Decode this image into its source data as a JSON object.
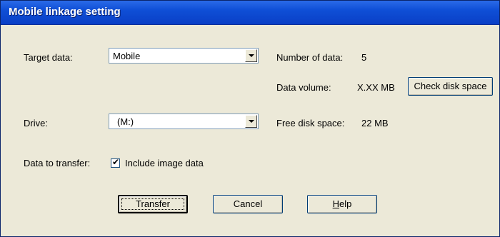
{
  "window": {
    "title": "Mobile linkage setting"
  },
  "form": {
    "target_data_label": "Target data:",
    "target_data_value": "Mobile",
    "drive_label": "Drive:",
    "drive_value": "(M:)",
    "data_to_transfer_label": "Data to transfer:",
    "include_image_label": "Include image data",
    "include_image_checked": true
  },
  "info": {
    "number_of_data_label": "Number of data:",
    "number_of_data_value": "5",
    "data_volume_label": "Data volume:",
    "data_volume_value": "X.XX MB",
    "free_disk_space_label": "Free disk space:",
    "free_disk_space_value": "22 MB"
  },
  "buttons": {
    "check_disk_space": "Check disk space",
    "transfer": "Transfer",
    "cancel": "Cancel",
    "help_prefix": "H",
    "help_rest": "elp"
  },
  "colors": {
    "titlebar": "#0f4fd6",
    "dialog_background": "#ece9d8"
  },
  "icons": {
    "dropdown": "chevron-down-icon",
    "checkbox": "checkmark-icon"
  }
}
